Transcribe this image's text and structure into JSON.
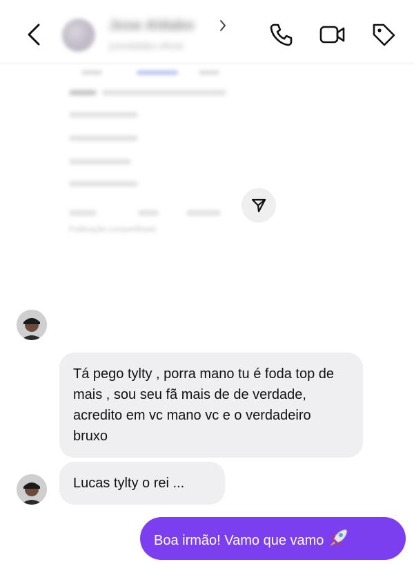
{
  "header": {
    "contact_name": "Jose Aldabo",
    "contact_subtitle": "josealdabo.oficial",
    "icons": [
      "back-icon",
      "chevron-right-icon",
      "phone-icon",
      "video-camera-icon",
      "tag-icon"
    ]
  },
  "shared_post": {
    "caption": "Publicação compartilhada"
  },
  "messages": [
    {
      "sender": "contact",
      "text": "Tá pego tylty , porra mano tu é foda top de mais , sou seu fã mais de de verdade, acredito em vc mano vc e o verdadeiro bruxo"
    },
    {
      "sender": "contact",
      "text": "Lucas tylty o rei ..."
    },
    {
      "sender": "me",
      "text": "Boa irmão! Vamo que vamo"
    }
  ],
  "colors": {
    "outgoing_bubble": "#7b3ff0",
    "incoming_bubble": "#efeff1",
    "background": "#ffffff"
  }
}
